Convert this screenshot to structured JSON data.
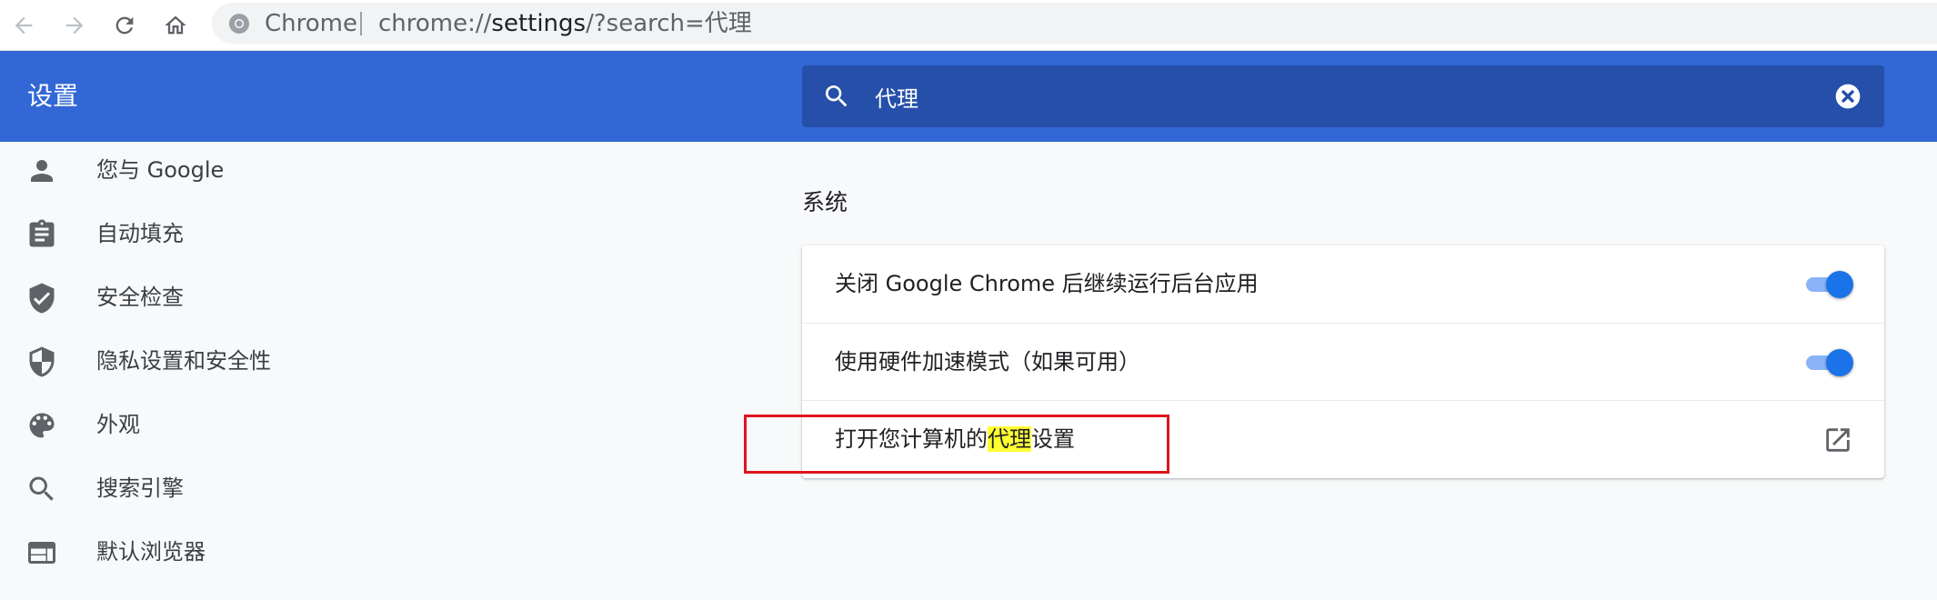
{
  "browser": {
    "site_name": "Chrome",
    "url_scheme": "chrome://",
    "url_host": "settings",
    "url_rest": "/?search=代理",
    "icons": [
      "back-arrow-icon",
      "forward-arrow-icon",
      "reload-icon",
      "home-icon",
      "chrome-logo-icon"
    ]
  },
  "header": {
    "title": "设置",
    "search": {
      "value": "代理",
      "icons": [
        "search-icon",
        "clear-circle-icon"
      ]
    }
  },
  "sidebar": {
    "items": [
      {
        "label": "您与 Google",
        "icon": "person-icon"
      },
      {
        "label": "自动填充",
        "icon": "clipboard-icon"
      },
      {
        "label": "安全检查",
        "icon": "shield-check-icon"
      },
      {
        "label": "隐私设置和安全性",
        "icon": "shield-half-icon"
      },
      {
        "label": "外观",
        "icon": "palette-icon"
      },
      {
        "label": "搜索引擎",
        "icon": "search-icon"
      },
      {
        "label": "默认浏览器",
        "icon": "browser-window-icon"
      }
    ]
  },
  "main": {
    "section_title": "系统",
    "rows": [
      {
        "label": "关闭 Google Chrome 后继续运行后台应用",
        "control": "toggle",
        "checked": true
      },
      {
        "label": "使用硬件加速模式（如果可用）",
        "control": "toggle",
        "checked": true
      },
      {
        "label_before": "打开您计算机的",
        "label_highlight": "代理",
        "label_after": "设置",
        "control": "external-link-icon"
      }
    ]
  },
  "colors": {
    "header_blue": "#3367d6",
    "search_box": "#254fa9",
    "toggle_on": "#1a73e8",
    "highlight": "#ffff33",
    "annotation_red": "#e0141c"
  }
}
